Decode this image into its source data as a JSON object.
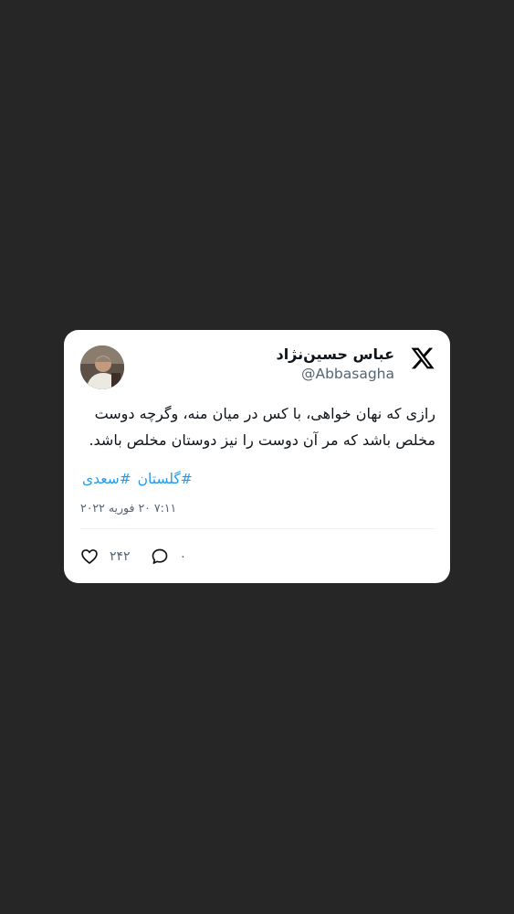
{
  "tweet": {
    "display_name": "عباس حسین‌نژاد",
    "handle": "@Abbasagha",
    "text": "رازی که نهان خواهی، با کس در میان منه، وگرچه دوست مخلص باشد که مر آن دوست را نیز دوستان مخلص باشد.",
    "hashtags": [
      "#سعدی",
      "#گلستان"
    ],
    "timestamp": "۷:۱۱ ۲۰ فوریه ۲۰۲۲",
    "likes": "۲۴۲",
    "replies": "۰"
  },
  "colors": {
    "background": "#262626",
    "card": "#ffffff",
    "accent": "#1d9bf0",
    "muted": "#536471"
  },
  "icons": {
    "brand": "x-logo-icon",
    "like": "heart-icon",
    "reply": "reply-bubble-icon"
  }
}
